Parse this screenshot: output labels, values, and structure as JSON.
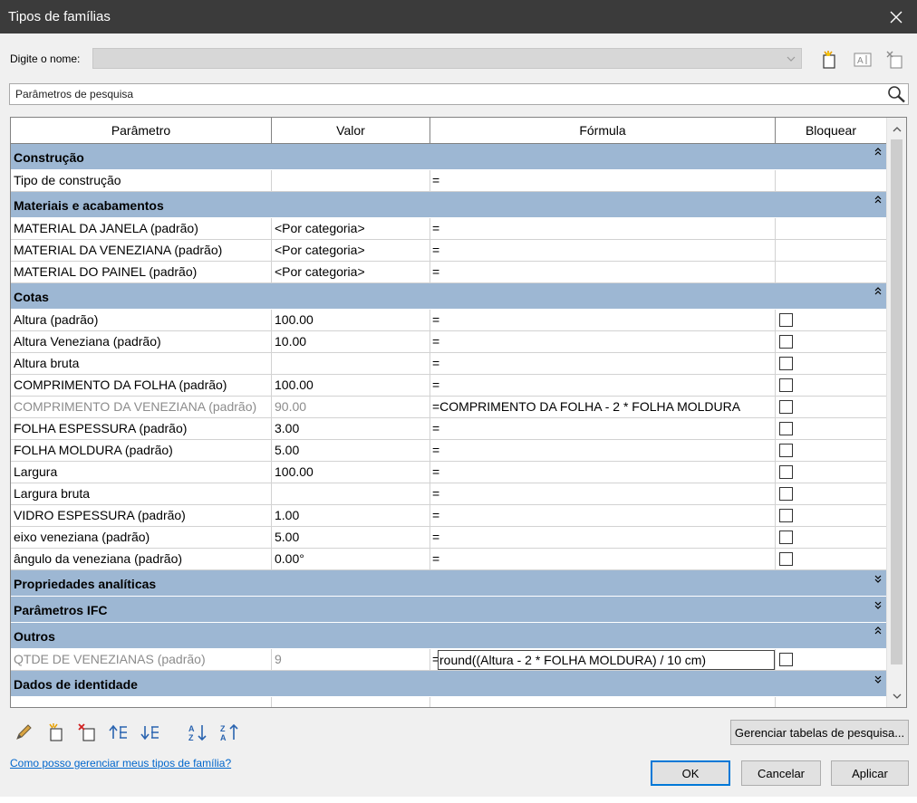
{
  "window": {
    "title": "Tipos de famílias"
  },
  "name_row": {
    "label": "Digite o nome:",
    "value": ""
  },
  "search": {
    "value": "Parâmetros de pesquisa"
  },
  "columns": [
    "Parâmetro",
    "Valor",
    "Fórmula",
    "Bloquear"
  ],
  "groups": {
    "construcao": {
      "label": "Construção",
      "rows": [
        {
          "param": "Tipo de construção",
          "value": "",
          "formula": "="
        }
      ]
    },
    "materiais": {
      "label": "Materiais e acabamentos",
      "rows": [
        {
          "param": "MATERIAL DA JANELA (padrão)",
          "value": "<Por categoria>",
          "formula": "="
        },
        {
          "param": "MATERIAL DA VENEZIANA (padrão)",
          "value": "<Por categoria>",
          "formula": "="
        },
        {
          "param": "MATERIAL DO PAINEL (padrão)",
          "value": "<Por categoria>",
          "formula": "="
        }
      ]
    },
    "cotas": {
      "label": "Cotas",
      "rows": [
        {
          "param": "Altura (padrão)",
          "value": "100.00",
          "formula": "="
        },
        {
          "param": "Altura Veneziana (padrão)",
          "value": "10.00",
          "formula": "="
        },
        {
          "param": "Altura bruta",
          "value": "",
          "formula": "="
        },
        {
          "param": "COMPRIMENTO DA FOLHA (padrão)",
          "value": "100.00",
          "formula": "="
        },
        {
          "param": "COMPRIMENTO DA VENEZIANA (padrão)",
          "value": "90.00",
          "formula": "=COMPRIMENTO DA FOLHA - 2 * FOLHA MOLDURA"
        },
        {
          "param": "FOLHA ESPESSURA (padrão)",
          "value": "3.00",
          "formula": "="
        },
        {
          "param": "FOLHA MOLDURA (padrão)",
          "value": "5.00",
          "formula": "="
        },
        {
          "param": "Largura",
          "value": "100.00",
          "formula": "="
        },
        {
          "param": "Largura bruta",
          "value": "",
          "formula": "="
        },
        {
          "param": "VIDRO ESPESSURA (padrão)",
          "value": "1.00",
          "formula": "="
        },
        {
          "param": "eixo veneziana (padrão)",
          "value": "5.00",
          "formula": "="
        },
        {
          "param": "ângulo da veneziana (padrão)",
          "value": "0.00°",
          "formula": "="
        }
      ]
    },
    "analiticas": {
      "label": "Propriedades analíticas"
    },
    "ifc": {
      "label": "Parâmetros IFC"
    },
    "outros": {
      "label": "Outros",
      "rows": [
        {
          "param": "QTDE DE VENEZIANAS (padrão)",
          "value": "9",
          "formula_prefix": "=",
          "formula": "round((Altura - 2 * FOLHA MOLDURA) / 10 cm)"
        }
      ]
    },
    "identidade": {
      "label": "Dados de identidade"
    }
  },
  "buttons": {
    "lookup_tables": "Gerenciar tabelas de pesquisa...",
    "ok": "OK",
    "cancel": "Cancelar",
    "apply": "Aplicar"
  },
  "help_link": "Como posso gerenciar meus tipos de família?",
  "icons": {
    "new_type": "new-type-icon",
    "rename_type": "rename-type-icon",
    "delete_type": "delete-type-icon",
    "search": "magnifier-icon"
  }
}
